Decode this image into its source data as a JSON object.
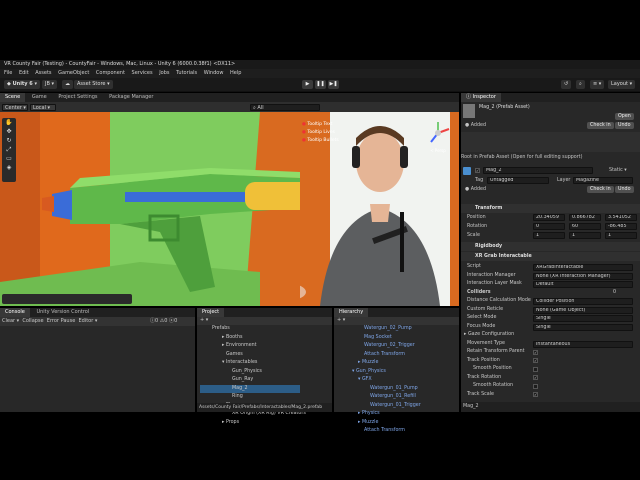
{
  "window": {
    "title": "VR County Fair (Testing) - CountyFair - Windows, Mac, Linux - Unity 6 (6000.0.38f1) <DX11>"
  },
  "menu": [
    "File",
    "Edit",
    "Assets",
    "GameObject",
    "Component",
    "Services",
    "Jobs",
    "Tutorials",
    "Window",
    "Help"
  ],
  "toolbar": {
    "account": "JB",
    "asset_store": "Asset Store",
    "layout": "Layout"
  },
  "scene_tabs": [
    "Scene",
    "Game",
    "Project Settings",
    "Package Manager"
  ],
  "scene_toolbar": {
    "pivot": "Center",
    "space": "Local",
    "search_placeholder": "All"
  },
  "scene": {
    "gizmo_label": "< Persp",
    "notes": [
      "Tooltip Text",
      "Tooltip Lives",
      "Tooltip Bullets"
    ]
  },
  "bottom_tabs": {
    "console": "Console",
    "uvc": "Unity Version Control",
    "project": "Project",
    "hierarchy": "Hierarchy"
  },
  "console": {
    "clear": "Clear",
    "collapse": "Collapse",
    "error_pause": "Error Pause",
    "editor": "Editor",
    "counts": [
      "0",
      "0",
      "0"
    ]
  },
  "project_tree": [
    "Prefabs",
    "Booths",
    "Environment",
    "Games",
    "Interactables",
    "Gun_Physics",
    "Gun_Ray",
    "Mag_2",
    "Ring",
    "Player",
    "XR Origin (XR Rig) VR Creators",
    "Props"
  ],
  "project_path": "Assets/County Fair/Prefabs/Interactables/Mag_2.prefab",
  "hierarchy": [
    "Watergun_02_Pump",
    "Mag Socket",
    "Watergun_02_Trigger",
    "Attach Transform",
    "Muzzle",
    "Gun_Physics",
    "GFX",
    "Watergun_01_Pump",
    "Watergun_01_Refill",
    "Watergun_01_Trigger",
    "Physics",
    "Muzzle",
    "Attach Transform"
  ],
  "inspector": {
    "tab": "Inspector",
    "asset_title": "Mag_2 (Prefab Asset)",
    "open_btn": "Open",
    "added": "Added",
    "checkin": "Check in",
    "undo": "Undo",
    "root_note": "Root in Prefab Asset (Open for full editing support)",
    "go_name": "Mag_2",
    "static": "Static",
    "tag_label": "Tag",
    "tag": "Untagged",
    "layer_label": "Layer",
    "layer": "Magazine",
    "transform": "Transform",
    "pos_label": "Position",
    "pos": [
      "20.34059",
      "0.866782",
      "3.541052"
    ],
    "rot_label": "Rotation",
    "rot": [
      "0",
      "60",
      "-86.485"
    ],
    "scale_label": "Scale",
    "scale": [
      "1",
      "1",
      "1"
    ],
    "rigidbody": "Rigidbody",
    "xr_grab": "XR Grab Interactable",
    "props": [
      {
        "label": "Script",
        "value": "XRGrabInteractable"
      },
      {
        "label": "Interaction Manager",
        "value": "None (XR Interaction Manager)"
      },
      {
        "label": "Interaction Layer Mask",
        "value": "Default"
      },
      {
        "label": "Colliders",
        "value": "0"
      },
      {
        "label": "Distance Calculation Mode",
        "value": "Collider Position"
      },
      {
        "label": "Custom Reticle",
        "value": "None (Game Object)"
      },
      {
        "label": "Select Mode",
        "value": "Single"
      },
      {
        "label": "Focus Mode",
        "value": "Single"
      },
      {
        "label": "Gaze Configuration",
        "value": ""
      },
      {
        "label": "Movement Type",
        "value": "Instantaneous"
      },
      {
        "label": "Retain Transform Parent",
        "value": "✓"
      },
      {
        "label": "Track Position",
        "value": "✓"
      },
      {
        "label": "Smooth Position",
        "value": ""
      },
      {
        "label": "Track Rotation",
        "value": "✓"
      },
      {
        "label": "Smooth Rotation",
        "value": ""
      },
      {
        "label": "Track Scale",
        "value": "✓"
      }
    ],
    "footer": "Mag_2"
  }
}
